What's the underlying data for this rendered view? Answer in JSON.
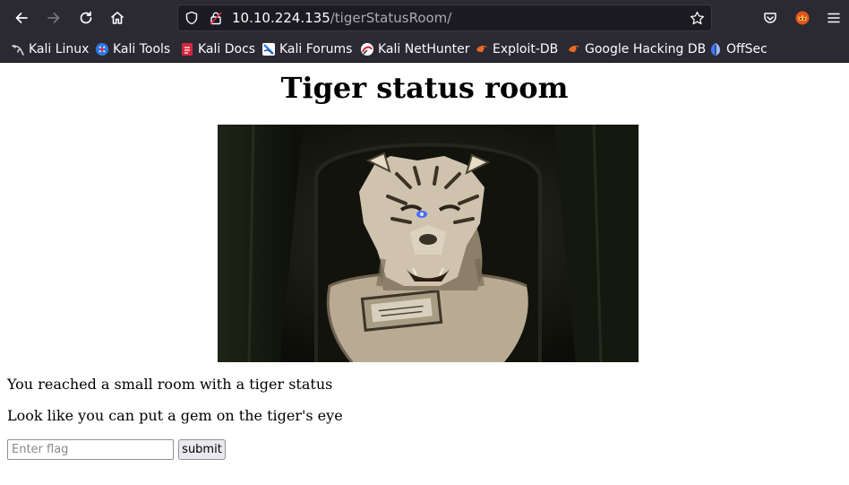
{
  "browser": {
    "url_host": "10.10.224.135",
    "url_path": "/tigerStatusRoom/",
    "bookmarks": [
      {
        "label": "Kali Linux",
        "icon": "kali-dragon-icon"
      },
      {
        "label": "Kali Tools",
        "icon": "kali-tools-icon"
      },
      {
        "label": "Kali Docs",
        "icon": "kali-docs-icon"
      },
      {
        "label": "Kali Forums",
        "icon": "kali-forums-icon"
      },
      {
        "label": "Kali NetHunter",
        "icon": "kali-nethunter-icon"
      },
      {
        "label": "Exploit-DB",
        "icon": "exploit-db-icon"
      },
      {
        "label": "Google Hacking DB",
        "icon": "ghdb-icon"
      },
      {
        "label": "OffSec",
        "icon": "offsec-icon"
      }
    ]
  },
  "page": {
    "title": "Tiger status room",
    "line1": "You reached a small room with a tiger status",
    "line2": "Look like you can put a gem on the tiger's eye",
    "flag_placeholder": "Enter flag",
    "submit_label": "submit"
  },
  "colors": {
    "chrome_bg": "#2b2a33",
    "urlbar_bg": "#1c1b22",
    "tiger_eye": "#4b6cff"
  }
}
